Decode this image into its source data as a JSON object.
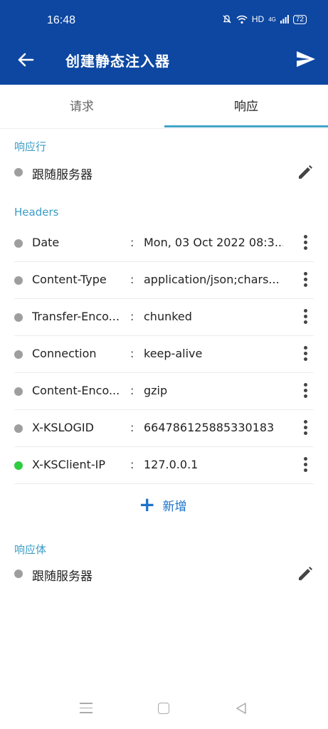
{
  "status_bar": {
    "time": "16:48",
    "network": "HD",
    "signal": "4G",
    "battery": "72"
  },
  "toolbar": {
    "title": "创建静态注入器",
    "back_icon": "arrow-left-icon",
    "send_icon": "send-icon"
  },
  "tabs": [
    {
      "label": "请求",
      "selected": false
    },
    {
      "label": "响应",
      "selected": true
    }
  ],
  "colors": {
    "app_bar": "#0d47a1",
    "accent": "#3a9cc6",
    "dot_inactive": "#9e9e9e",
    "dot_active": "#2ecc40"
  },
  "response_line": {
    "section_title": "响应行",
    "label": "跟随服务器"
  },
  "headers": {
    "section_title": "Headers",
    "separator": ":",
    "rows": [
      {
        "key": "Date",
        "value": "Mon, 03 Oct 2022 08:3...",
        "active": false
      },
      {
        "key": "Content-Type",
        "value": "application/json;chars...",
        "active": false
      },
      {
        "key": "Transfer-Enco...",
        "value": "chunked",
        "active": false
      },
      {
        "key": "Connection",
        "value": "keep-alive",
        "active": false
      },
      {
        "key": "Content-Enco...",
        "value": "gzip",
        "active": false
      },
      {
        "key": "X-KSLOGID",
        "value": "664786125885330183",
        "active": false
      },
      {
        "key": "X-KSClient-IP",
        "value": "127.0.0.1",
        "active": true
      }
    ],
    "add_label": "新增"
  },
  "response_body": {
    "section_title": "响应体",
    "label": "跟随服务器"
  }
}
